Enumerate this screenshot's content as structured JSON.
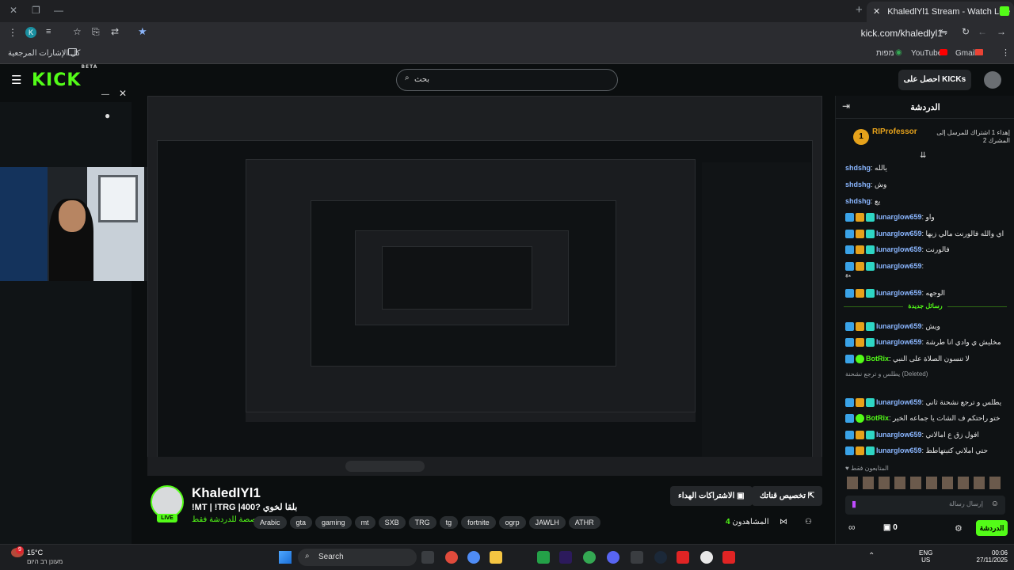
{
  "browser": {
    "tab_title": "KhaledlYl1 Stream - Watch Live",
    "url": "kick.com/khaledlyl1",
    "bookmarks_all": "كل الإشارات المرجعية",
    "bookmarks": [
      "Gmail",
      "YouTube",
      "מפות"
    ],
    "profile_letter": "K"
  },
  "kick": {
    "logo": "KICK",
    "logo_beta": "BETA",
    "search_placeholder": "بحث",
    "get_kicks": "احصل على KICKs"
  },
  "stream": {
    "streamer": "KhaledlYl1",
    "title": "!MT | !TRG |400? بلقا لخوي",
    "category": "مخصصة للدردشة فقط",
    "live": "LIVE",
    "tags": [
      "Arabic",
      "gta",
      "gaming",
      "mt",
      "SXB",
      "TRG",
      "tg",
      "fortnite",
      "ogrp",
      "JAWLH",
      "ATHR"
    ],
    "subscribe_gift": "الاشتراكات الهداء",
    "customize_channel": "تخصيص قناتك",
    "viewers_label": "المشاهدون",
    "viewers": "4"
  },
  "chat": {
    "title": "الدردشة",
    "pinned_user": "RIProfessor",
    "pinned_text": "إهداء 1 اشتراك للمرسل إلى المشرك 2",
    "pinned_count": "1",
    "messages": [
      {
        "user": "shdshg",
        "text": "يالله",
        "color": "blue"
      },
      {
        "user": "shdshg",
        "text": "وش",
        "color": "blue"
      },
      {
        "user": "shdshg",
        "text": "يع",
        "color": "blue"
      },
      {
        "user": "lunarglow659",
        "text": "واو",
        "color": "blue"
      },
      {
        "user": "lunarglow659",
        "text": "اي والله فالورنت مالي زيها",
        "color": "blue"
      },
      {
        "user": "lunarglow659",
        "text": "فالورنت",
        "color": "blue"
      },
      {
        "user": "lunarglow659",
        "text": "",
        "color": "blue"
      },
      {
        "user": "",
        "text": "*ًًًًًًًًًًًًًًًًًًًًًًًًًً*",
        "color": "blue"
      },
      {
        "user": "lunarglow659",
        "text": "الوجهه",
        "color": "blue"
      }
    ],
    "new_messages": "رسائل جديدة",
    "messages2": [
      {
        "user": "lunarglow659",
        "text": "ويش",
        "color": "blue"
      },
      {
        "user": "lunarglow659",
        "text": "مخليش ي وادي انا طرشة",
        "color": "blue"
      },
      {
        "user": "BotRix",
        "text": "لا تنسون الصلاة على النبي",
        "color": "green"
      },
      {
        "user": "",
        "text": "يطلس و ترجع نشحنة (Deleted)",
        "color": "blue"
      },
      {
        "user": "lunarglow659",
        "text": "يطلس و ترجع نشحنة ثاني",
        "color": "blue"
      },
      {
        "user": "BotRix",
        "text": "ختو راحتكم ف الشات يا جماعه الخير",
        "color": "green"
      },
      {
        "user": "lunarglow659",
        "text": "افول زق ع امالاتي",
        "color": "blue"
      },
      {
        "user": "lunarglow659",
        "text": "حتي املاني كتبتهاطط",
        "color": "blue"
      }
    ],
    "viewers_only": "المتابعون فقط",
    "input_placeholder": "إرسال رسالة",
    "send": "الدردشة",
    "points": "0"
  },
  "taskbar": {
    "weather_temp": "15°C",
    "weather_text": "מעונן רב היום",
    "weather_badge": "9",
    "search": "Search",
    "lang": "ENG",
    "region": "US",
    "time": "00:06",
    "date": "27/11/2025"
  }
}
